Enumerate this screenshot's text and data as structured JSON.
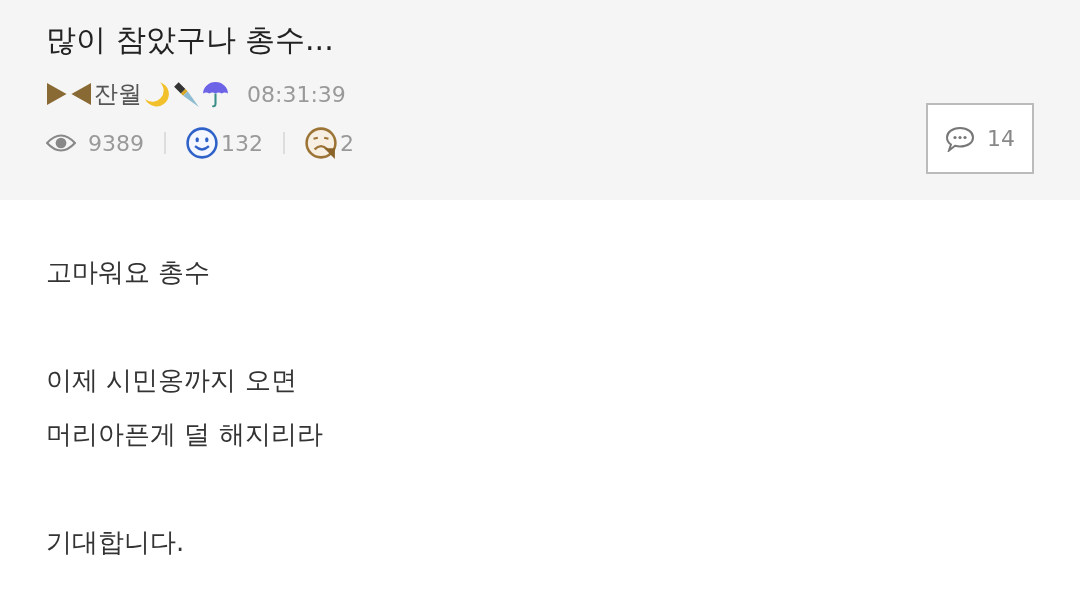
{
  "post": {
    "title": "많이 참았구나 총수...",
    "author": "잔월",
    "time": "08:31:39",
    "stats": [
      {
        "kind": "views",
        "count": "9389"
      },
      {
        "kind": "likes",
        "count": "132"
      },
      {
        "kind": "dislikes",
        "count": "2"
      }
    ],
    "comments_button": {
      "count": "14"
    }
  },
  "body": {
    "paragraphs": [
      {
        "lines": [
          "고마워요 총수"
        ]
      },
      {
        "lines": [
          "이제 시민옹까지 오면",
          "머리아픈게 덜 해지리라"
        ]
      },
      {
        "lines": [
          "기대합니다."
        ]
      }
    ]
  }
}
